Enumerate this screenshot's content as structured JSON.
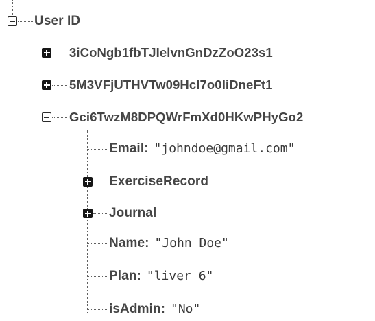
{
  "root": {
    "label": "User ID",
    "expanded": true,
    "children": [
      {
        "label": "3iCoNgb1fbTJIelvnGnDzZoO23s1",
        "expanded": false
      },
      {
        "label": "5M3VFjUTHVTw09Hcl7o0IiDneFt1",
        "expanded": false
      },
      {
        "label": "Gci6TwzM8DPQWrFmXd0HKwPHyGo2",
        "expanded": true,
        "fields": {
          "email": {
            "key": "Email",
            "value": "\"johndoe@gmail.com\""
          },
          "exercise_record": {
            "key": "ExerciseRecord",
            "expanded": false
          },
          "journal": {
            "key": "Journal",
            "expanded": false
          },
          "name": {
            "key": "Name",
            "value": "\"John Doe\""
          },
          "plan": {
            "key": "Plan",
            "value": "\"liver 6\""
          },
          "is_admin": {
            "key": "isAdmin",
            "value": "\"No\""
          }
        }
      }
    ]
  },
  "colon": ":",
  "icons": {
    "expanded": "minus-box-icon",
    "collapsed": "plus-box-icon"
  }
}
